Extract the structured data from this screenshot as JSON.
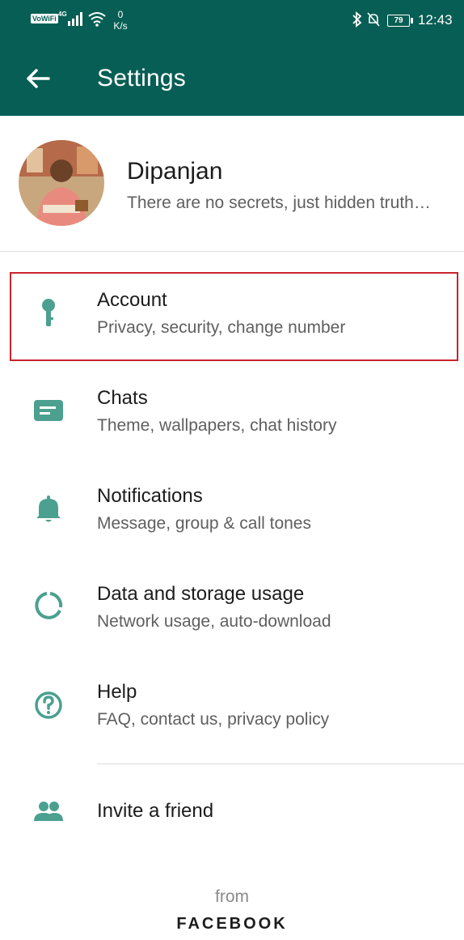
{
  "status_bar": {
    "vowifi": "VoWiFi",
    "network_type": "4G",
    "net_speed_value": "0",
    "net_speed_unit": "K/s",
    "battery": "79",
    "time": "12:43"
  },
  "app_bar": {
    "title": "Settings",
    "back_icon": "arrow-left-icon"
  },
  "profile": {
    "name": "Dipanjan",
    "status": "There are no secrets, just hidden truth…"
  },
  "menu": {
    "items": [
      {
        "icon": "key-icon",
        "label": "Account",
        "subtitle": "Privacy, security, change number"
      },
      {
        "icon": "chat-icon",
        "label": "Chats",
        "subtitle": "Theme, wallpapers, chat history"
      },
      {
        "icon": "bell-icon",
        "label": "Notifications",
        "subtitle": "Message, group & call tones"
      },
      {
        "icon": "data-usage-icon",
        "label": "Data and storage usage",
        "subtitle": "Network usage, auto-download"
      },
      {
        "icon": "help-icon",
        "label": "Help",
        "subtitle": "FAQ, contact us, privacy policy"
      },
      {
        "icon": "people-icon",
        "label": "Invite a friend"
      }
    ]
  },
  "footer": {
    "from": "from",
    "brand": "FACEBOOK"
  },
  "colors": {
    "primary": "#075e54",
    "icon": "#4ba08f",
    "highlight_border": "#c8242b"
  }
}
